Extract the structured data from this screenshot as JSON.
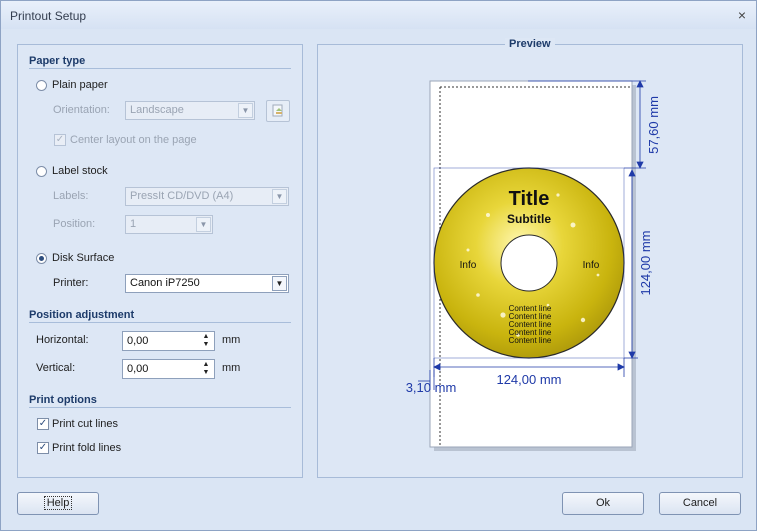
{
  "window": {
    "title": "Printout Setup",
    "close_symbol": "×"
  },
  "paper_type": {
    "title": "Paper type",
    "plain_paper": {
      "label": "Plain paper",
      "orientation_label": "Orientation:",
      "orientation_value": "Landscape",
      "center_layout_label": "Center layout on the page"
    },
    "label_stock": {
      "label": "Label stock",
      "labels_label": "Labels:",
      "labels_value": "PressIt CD/DVD (A4)",
      "position_label": "Position:",
      "position_value": "1"
    },
    "disk_surface": {
      "label": "Disk Surface",
      "printer_label": "Printer:",
      "printer_value": "Canon iP7250"
    }
  },
  "position_adjustment": {
    "title": "Position adjustment",
    "horizontal_label": "Horizontal:",
    "horizontal_value": "0,00",
    "vertical_label": "Vertical:",
    "vertical_value": "0,00",
    "unit": "mm"
  },
  "print_options": {
    "title": "Print options",
    "cut_lines_label": "Print cut lines",
    "fold_lines_label": "Print fold lines"
  },
  "preview": {
    "title": "Preview",
    "disc_title": "Title",
    "disc_subtitle": "Subtitle",
    "info_left": "Info",
    "info_right": "Info",
    "content_lines": [
      "Content line",
      "Content line",
      "Content line",
      "Content line",
      "Content line"
    ],
    "dim_top": "57,60 mm",
    "dim_height": "124,00 mm",
    "dim_width": "124,00 mm",
    "dim_left": "3,10 mm"
  },
  "buttons": {
    "help": "Help",
    "ok": "Ok",
    "cancel": "Cancel"
  },
  "colors": {
    "dimension": "#1f3aa8",
    "disc_gold": "#d8c51c"
  }
}
